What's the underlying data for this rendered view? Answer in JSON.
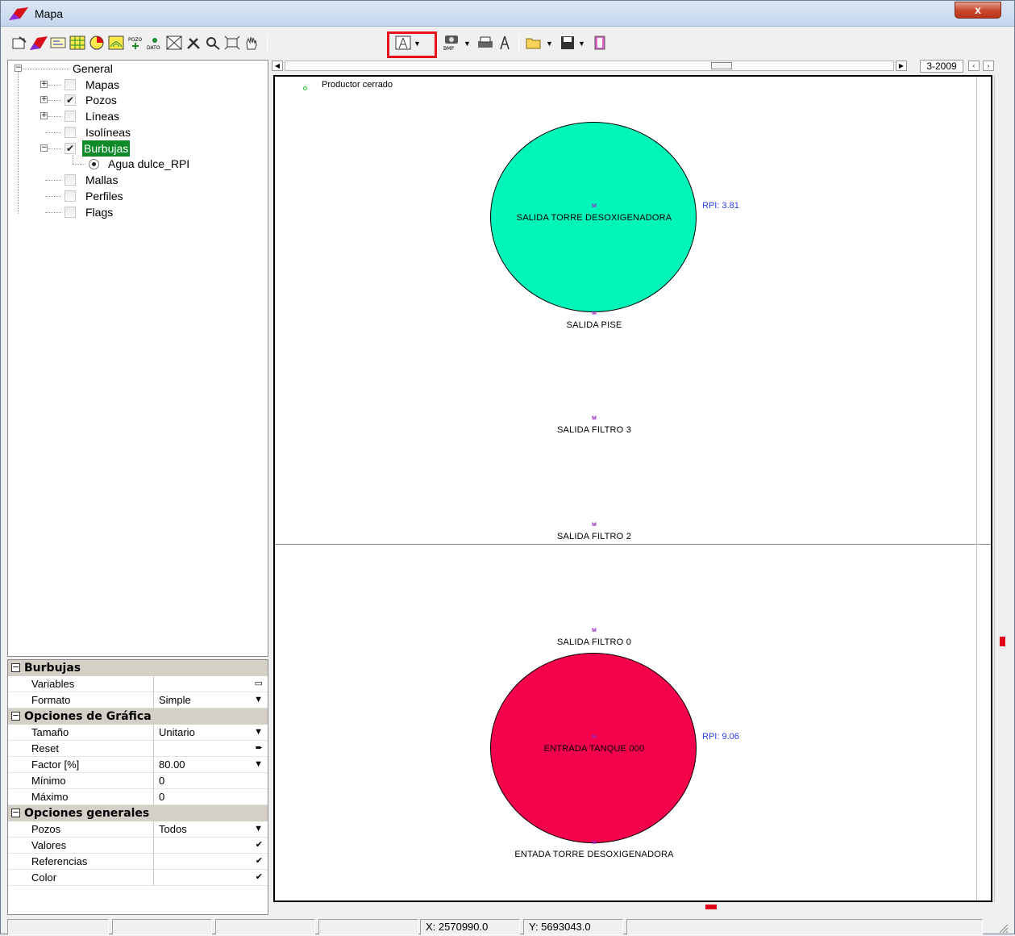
{
  "window": {
    "title": "Mapa",
    "close_glyph": "x"
  },
  "colors": {
    "accent_highlight": "#e8121f",
    "bubble_top": "#00f5b8",
    "bubble_bottom": "#f5004a",
    "tree_selection": "#0e8a2a",
    "rpi_text": "#2a3cf0"
  },
  "toolbar": {
    "icons": [
      "properties-icon",
      "map-icon",
      "layers-icon",
      "grid-icon",
      "pie-icon",
      "contour-icon",
      "well-data-icon",
      "data-point-icon",
      "zoom-box-icon",
      "tools-icon",
      "zoom-in-icon",
      "fit-extent-icon",
      "pan-hand-icon",
      "well-symbol-icon",
      "bmp-export-icon",
      "print-icon",
      "well-icon",
      "open-folder-icon",
      "save-icon",
      "book-icon"
    ]
  },
  "tree": {
    "items": [
      {
        "label": "General"
      },
      {
        "label": "Mapas",
        "checked": false
      },
      {
        "label": "Pozos",
        "checked": true
      },
      {
        "label": "Líneas",
        "checked": false
      },
      {
        "label": "Isolíneas",
        "checked": false
      },
      {
        "label": "Burbujas",
        "checked": true,
        "selected": true
      },
      {
        "label": "Agua dulce_RPI",
        "radio": true
      },
      {
        "label": "Mallas",
        "checked": false
      },
      {
        "label": "Perfiles",
        "checked": false
      },
      {
        "label": "Flags",
        "checked": false
      }
    ],
    "check_glyph": "✔"
  },
  "properties": {
    "sections": [
      {
        "title": "Burbujas",
        "rows": [
          {
            "name": "Variables",
            "value": "",
            "control": "▭"
          },
          {
            "name": "Formato",
            "value": "Simple",
            "control": "▼"
          }
        ]
      },
      {
        "title": "Opciones de Gráfica",
        "rows": [
          {
            "name": "Tamaño",
            "value": "Unitario",
            "control": "▼"
          },
          {
            "name": "Reset",
            "value": "",
            "control": "➨"
          },
          {
            "name": "Factor [%]",
            "value": "80.00",
            "control": "▼"
          },
          {
            "name": "Mínimo",
            "value": "0",
            "control": ""
          },
          {
            "name": "Máximo",
            "value": "0",
            "control": ""
          }
        ]
      },
      {
        "title": "Opciones generales",
        "rows": [
          {
            "name": "Pozos",
            "value": "Todos",
            "control": "▼"
          },
          {
            "name": "Valores",
            "value": "",
            "control": "✔"
          },
          {
            "name": "Referencias",
            "value": "",
            "control": "✔"
          },
          {
            "name": "Color",
            "value": "",
            "control": "✔"
          }
        ]
      }
    ]
  },
  "map": {
    "date": "3-2009",
    "legend": "Productor cerrado",
    "well_marker": "ᴍ",
    "wells": [
      {
        "label": "SALIDA TORRE DESOXIGENADORA",
        "rpi": "RPI: 3.81"
      },
      {
        "label": "SALIDA  PISE"
      },
      {
        "label": "SALIDA FILTRO 3"
      },
      {
        "label": "SALIDA FILTRO 2"
      },
      {
        "label": "SALIDA FILTRO 0"
      },
      {
        "label": "ENTRADA TANQUE 000",
        "rpi": "RPI: 9.06"
      },
      {
        "label": "ENTADA TORRE DESOXIGENADORA"
      }
    ]
  },
  "status": {
    "x": "X: 2570990.0",
    "y": "Y: 5693043.0"
  }
}
